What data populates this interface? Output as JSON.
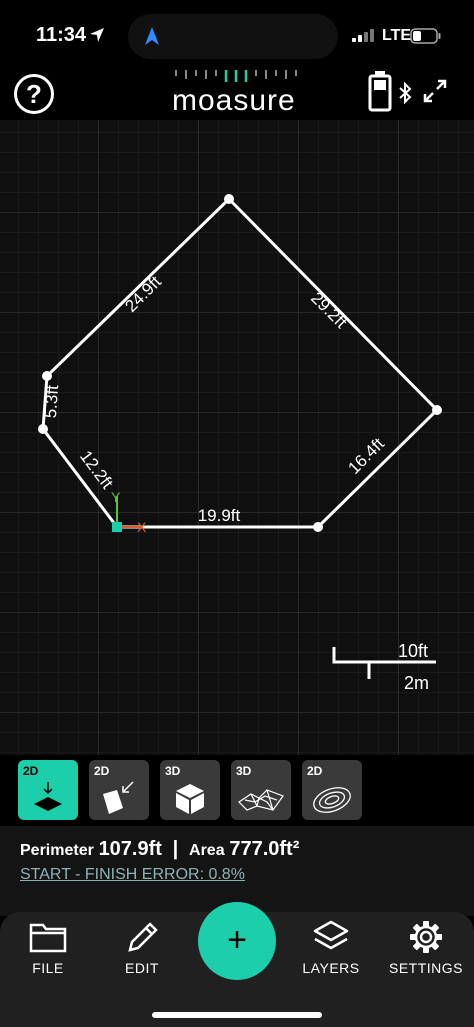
{
  "status_bar": {
    "time": "11:34",
    "network": "LTE"
  },
  "header": {
    "help_label": "?",
    "app_name": "moasure"
  },
  "measurements": {
    "edges": [
      {
        "label": "24.9ft"
      },
      {
        "label": "29.2ft"
      },
      {
        "label": "16.4ft"
      },
      {
        "label": "19.9ft"
      },
      {
        "label": "12.2ft"
      },
      {
        "label": "5.3ft"
      }
    ],
    "axis_labels": {
      "y": "Y",
      "x": "X"
    }
  },
  "scale": {
    "imperial": "10ft",
    "metric": "2m"
  },
  "view_modes": [
    {
      "tag": "2D",
      "icon": "2d-plan-icon",
      "active": true
    },
    {
      "tag": "2D",
      "icon": "2d-elevation-icon",
      "active": false
    },
    {
      "tag": "3D",
      "icon": "3d-cube-icon",
      "active": false
    },
    {
      "tag": "3D",
      "icon": "3d-terrain-icon",
      "active": false
    },
    {
      "tag": "2D",
      "icon": "2d-contour-icon",
      "active": false
    }
  ],
  "metrics": {
    "perimeter_label": "Perimeter",
    "perimeter_value": "107.9ft",
    "separator": "|",
    "area_label": "Area",
    "area_value": "777.0ft²",
    "error_text": "START - FINISH ERROR: 0.8%"
  },
  "tabs": {
    "file": "FILE",
    "edit": "EDIT",
    "add": "+",
    "layers": "LAYERS",
    "settings": "SETTINGS"
  },
  "colors": {
    "accent": "#1ccfaa",
    "background": "#000000"
  }
}
